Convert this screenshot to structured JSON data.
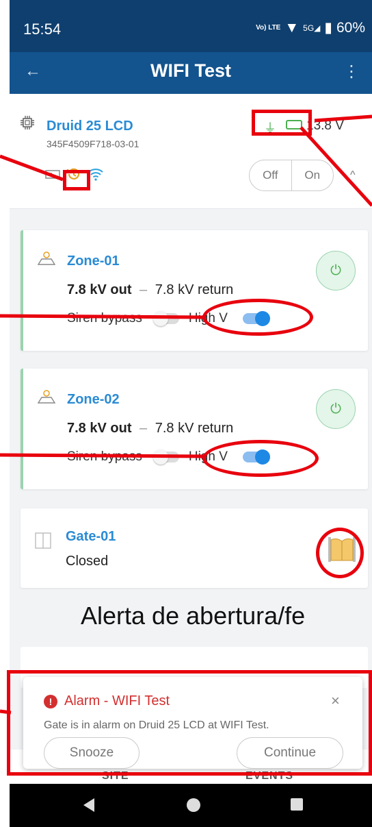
{
  "status_bar": {
    "time": "15:54",
    "network": "Vo) LTE",
    "network_5g": "5G",
    "battery": "60%"
  },
  "app_bar": {
    "title": "WIFI Test"
  },
  "device": {
    "name": "Druid 25 LCD",
    "serial": "345F4509F718-03-01",
    "voltage": "13.8 V",
    "off_label": "Off",
    "on_label": "On"
  },
  "zones": [
    {
      "name": "Zone-01",
      "out": "7.8 kV out",
      "dash": "–",
      "return": "7.8 kV return",
      "bypass_label": "Siren bypass",
      "bypass_on": false,
      "highv_label": "High V",
      "highv_on": true
    },
    {
      "name": "Zone-02",
      "out": "7.8 kV out",
      "dash": "–",
      "return": "7.8 kV return",
      "bypass_label": "Siren bypass",
      "bypass_on": false,
      "highv_label": "High V",
      "highv_on": true
    }
  ],
  "gate": {
    "name": "Gate-01",
    "status": "Closed"
  },
  "caption": "Alerta de abertura/fe",
  "notification": {
    "title": "Alarm - WIFI Test",
    "message": "Gate is in alarm on Druid 25 LCD at WIFI Test.",
    "snooze": "Snooze",
    "continue": "Continue"
  },
  "bottom_nav": {
    "site": "SITE",
    "events": "EVENTS"
  },
  "colors": {
    "status_bar": "#0f3f6e",
    "app_bar": "#13538e",
    "link_blue": "#2a8bd4",
    "zone_green": "#9ad3ae",
    "annotation_red": "#e8000d",
    "alarm_red": "#d32f2f"
  }
}
